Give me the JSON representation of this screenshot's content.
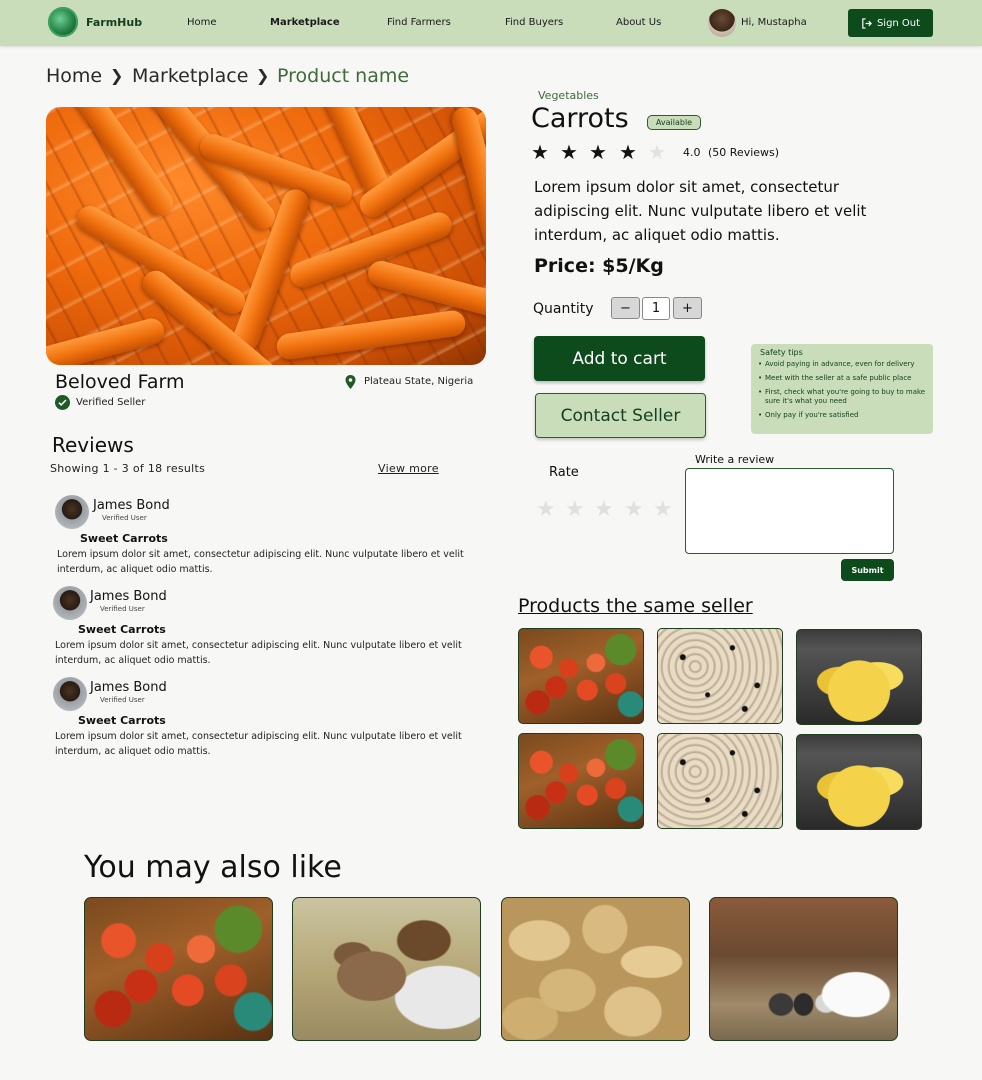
{
  "nav": {
    "brand": "FarmHub",
    "links": [
      "Home",
      "Marketplace",
      "Find Farmers",
      "Find Buyers",
      "About Us"
    ],
    "active": "Marketplace",
    "greeting": "Hi, Mustapha",
    "signout": "Sign Out"
  },
  "breadcrumb": [
    "Home",
    "Marketplace",
    "Product name"
  ],
  "seller": {
    "farm_name": "Beloved Farm",
    "verified": "Verified Seller",
    "location": "Plateau State, Nigeria"
  },
  "reviews": {
    "title": "Reviews",
    "showing": "Showing 1 - 3 of 18 results",
    "view_more": "View more",
    "items": [
      {
        "name": "James Bond",
        "badge": "Verified User",
        "title": "Sweet Carrots",
        "body": "Lorem ipsum dolor sit amet, consectetur adipiscing elit. Nunc vulputate libero et velit interdum, ac aliquet odio mattis."
      },
      {
        "name": "James Bond",
        "badge": "Verified User",
        "title": "Sweet Carrots",
        "body": "Lorem ipsum dolor sit amet, consectetur adipiscing elit. Nunc vulputate libero et velit interdum, ac aliquet odio mattis."
      },
      {
        "name": "James Bond",
        "badge": "Verified User",
        "title": "Sweet Carrots",
        "body": "Lorem ipsum dolor sit amet, consectetur adipiscing elit. Nunc vulputate libero et velit interdum, ac aliquet odio mattis."
      }
    ]
  },
  "product": {
    "category": "Vegetables",
    "name": "Carrots",
    "status": "Available",
    "rating": 4,
    "rating_value": "4.0",
    "rating_count": "(50 Reviews)",
    "description": "Lorem ipsum dolor sit amet, consectetur adipiscing elit. Nunc vulputate libero et velit interdum, ac aliquet odio mattis.",
    "price": "Price: $5/Kg",
    "quantity_label": "Quantity",
    "quantity": "1",
    "minus": "−",
    "plus": "+",
    "add_to_cart": "Add to cart",
    "contact_seller": "Contact Seller"
  },
  "safety": {
    "title": "Safety tips",
    "tips": [
      "Avoid paying in advance, even for delivery",
      "Meet with the seller at a safe public place",
      "First, check what you're going to buy to make sure it's what you need",
      "Only pay if you're satisfied"
    ]
  },
  "rate": {
    "label": "Rate",
    "write_label": "Write a review",
    "submit": "Submit"
  },
  "same_seller": {
    "title": "Products the same seller",
    "items": [
      "tomatoes",
      "beans",
      "bananas",
      "tomatoes",
      "beans",
      "bananas"
    ]
  },
  "may_like": {
    "title": "You may also like",
    "items": [
      "tomatoes",
      "goat",
      "peanuts",
      "rabbits"
    ]
  },
  "colors": {
    "brand_dark": "#0d4a1c",
    "brand_light": "#c9ddba",
    "accent_text": "#3f6a3a"
  }
}
